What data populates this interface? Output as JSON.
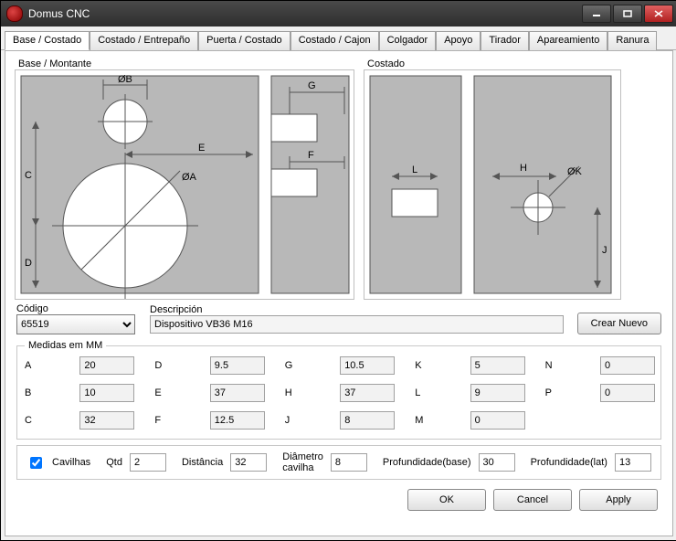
{
  "window": {
    "title": "Domus CNC"
  },
  "tabs": [
    "Base / Costado",
    "Costado / Entrepaño",
    "Puerta / Costado",
    "Costado / Cajon",
    "Colgador",
    "Apoyo",
    "Tirador",
    "Apareamiento",
    "Ranura"
  ],
  "active_tab": 0,
  "diagram_labels": {
    "left": "Base / Montante",
    "right": "Costado",
    "A": "ØA",
    "B": "ØB",
    "C": "C",
    "D": "D",
    "E": "E",
    "F": "F",
    "G": "G",
    "H": "H",
    "J": "J",
    "K": "ØK",
    "L": "L"
  },
  "form": {
    "codigo_label": "Código",
    "codigo_value": "65519",
    "descripcion_label": "Descripción",
    "descripcion_value": "Dispositivo VB36 M16",
    "crear_nuevo": "Crear Nuevo"
  },
  "medidas": {
    "legend": "Medidas em MM",
    "fields": {
      "A": "20",
      "B": "10",
      "C": "32",
      "D": "9.5",
      "E": "37",
      "F": "12.5",
      "G": "10.5",
      "H": "37",
      "J": "8",
      "K": "5",
      "L": "9",
      "M": "0",
      "N": "0",
      "P": "0"
    }
  },
  "cavilhas": {
    "checkbox_label": "Cavilhas",
    "checked": true,
    "qtd_label": "Qtd",
    "qtd": "2",
    "dist_label": "Distância",
    "dist": "32",
    "diam_label": "Diâmetro cavilha",
    "diam": "8",
    "prof_base_label": "Profundidade(base)",
    "prof_base": "30",
    "prof_lat_label": "Profundidade(lat)",
    "prof_lat": "13"
  },
  "buttons": {
    "ok": "OK",
    "cancel": "Cancel",
    "apply": "Apply"
  }
}
